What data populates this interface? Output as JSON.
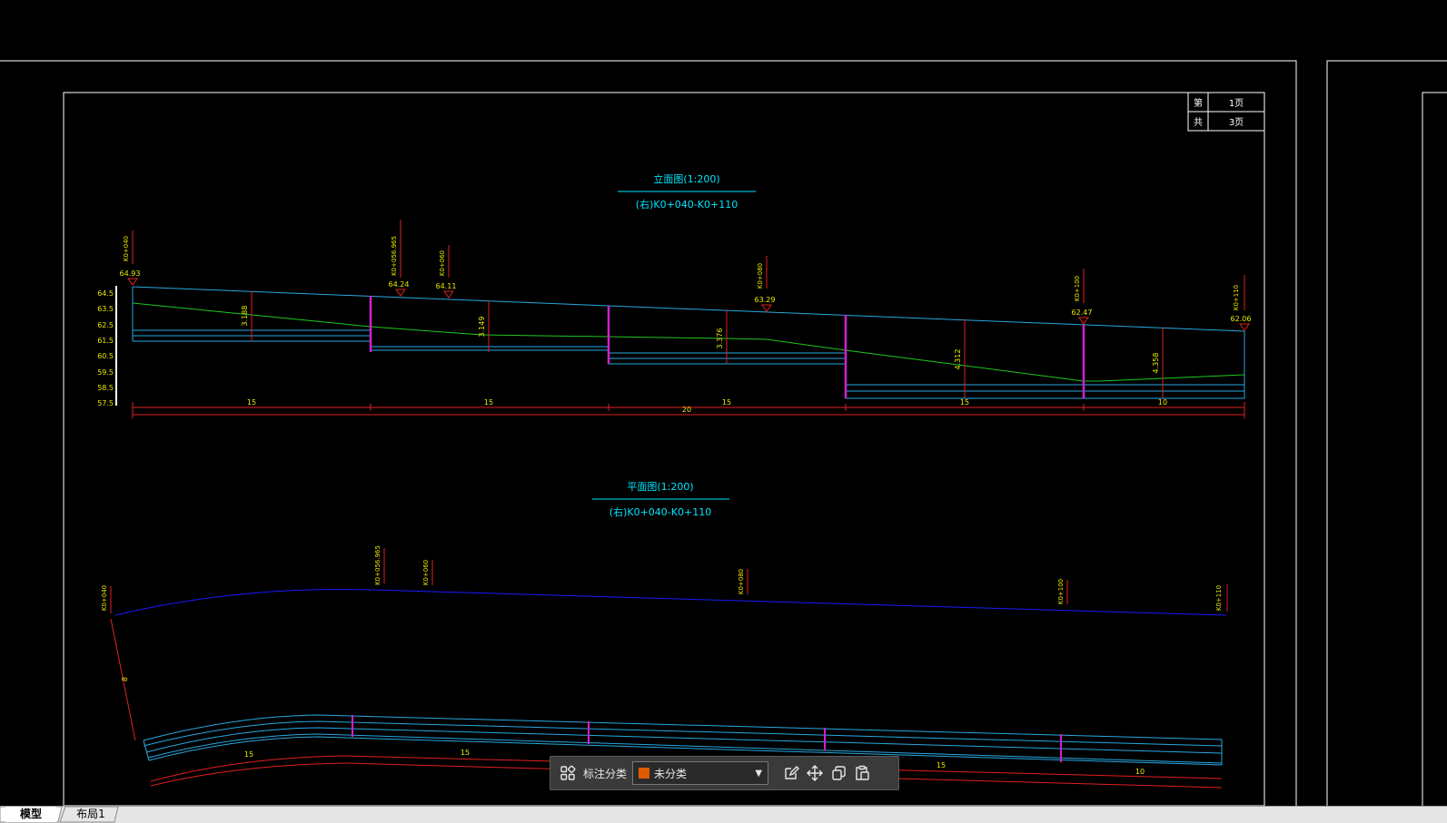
{
  "colors": {
    "background": "#000000",
    "frame": "#ffffff",
    "title": "#00e5ff",
    "surface": "#29a8e0",
    "ground": "#1ec81e",
    "dimension": "#e02020",
    "post": "#d020d0",
    "label": "#e8e800",
    "centerline": "#1a1aff",
    "tag_color": "#e05a00"
  },
  "title_block": {
    "sheet_label": "第",
    "sheet_value": "1页",
    "total_label": "共",
    "total_value": "3页"
  },
  "profile": {
    "title": "立面图(1:200)",
    "subtitle": "(右)K0+040-K0+110",
    "scale_ticks": [
      "64.5",
      "63.5",
      "62.5",
      "61.5",
      "60.5",
      "59.5",
      "58.5",
      "57.5"
    ],
    "stations": [
      {
        "name": "K0+040",
        "elev": "64.93"
      },
      {
        "name": "K0+056.965",
        "elev": "64.24"
      },
      {
        "name": "K0+060",
        "elev": "64.11"
      },
      {
        "name": "K0+080",
        "elev": "63.29"
      },
      {
        "name": "K0+100",
        "elev": "62.47"
      },
      {
        "name": "K0+110",
        "elev": "62.06"
      }
    ],
    "heights": [
      "3.188",
      "3.149",
      "3.376",
      "4.312",
      "4.358"
    ],
    "segments": [
      "15",
      "15",
      "20",
      "15",
      "15",
      "10"
    ]
  },
  "plan": {
    "title": "平面图(1:200)",
    "subtitle": "(右)K0+040-K0+110",
    "stations": [
      "K0+040",
      "K0+056.965",
      "K0+060",
      "K0+080",
      "K0+100",
      "K0+110"
    ],
    "offset": "8",
    "segments": [
      "15",
      "15",
      "15",
      "15",
      "10"
    ]
  },
  "toolbar": {
    "group_icon": "components-icon",
    "label": "标注分类",
    "select_value": "未分类",
    "actions": [
      "edit-icon",
      "move-icon",
      "copy-icon",
      "paste-icon"
    ]
  },
  "tabs": [
    "模型",
    "布局1"
  ]
}
